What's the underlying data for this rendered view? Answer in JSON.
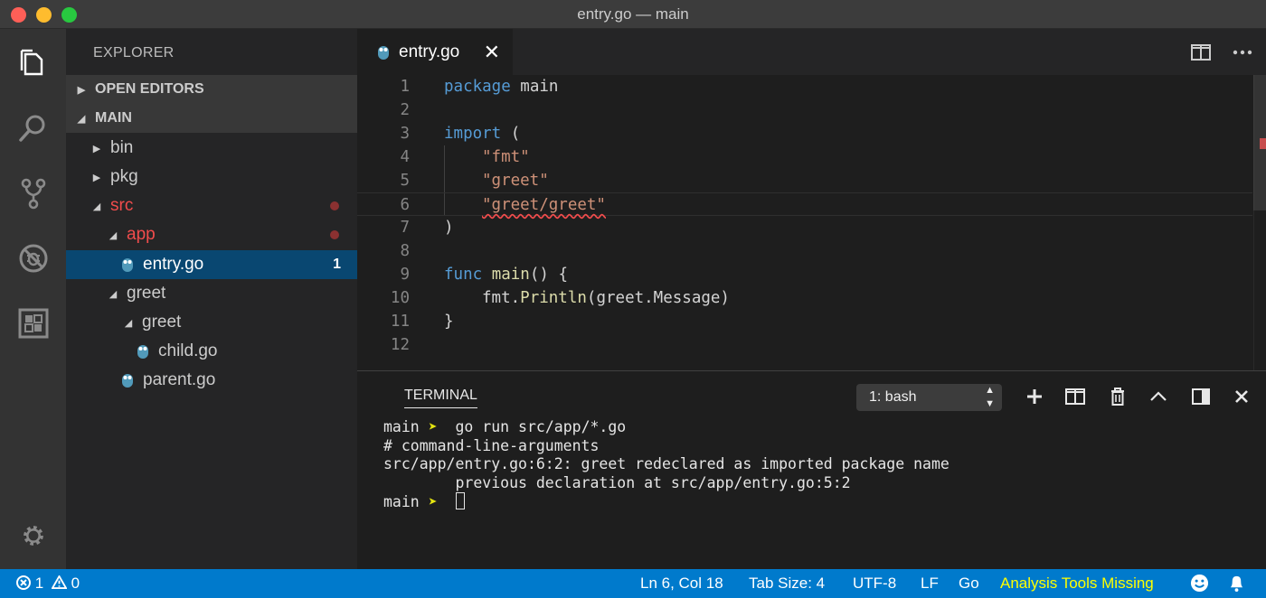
{
  "window": {
    "title": "entry.go — main"
  },
  "sidebar": {
    "title": "EXPLORER",
    "sections": {
      "open_editors": "OPEN EDITORS",
      "main": "MAIN"
    },
    "tree": [
      {
        "label": "bin"
      },
      {
        "label": "pkg"
      },
      {
        "label": "src"
      },
      {
        "label": "app"
      },
      {
        "label": "entry.go",
        "problems": "1"
      },
      {
        "label": "greet"
      },
      {
        "label": "greet"
      },
      {
        "label": "child.go"
      },
      {
        "label": "parent.go"
      }
    ]
  },
  "editor": {
    "tab_label": "entry.go",
    "tab_close": "✕",
    "lines": [
      {
        "num": "1"
      },
      {
        "num": "2"
      },
      {
        "num": "3"
      },
      {
        "num": "4"
      },
      {
        "num": "5"
      },
      {
        "num": "6"
      },
      {
        "num": "7"
      },
      {
        "num": "8"
      },
      {
        "num": "9"
      },
      {
        "num": "10"
      },
      {
        "num": "11"
      },
      {
        "num": "12"
      }
    ],
    "code": {
      "l1_kw": "package",
      "l1_rest": " main",
      "l3_kw": "import",
      "l3_rest": " (",
      "l4": "\"fmt\"",
      "l5": "\"greet\"",
      "l6": "\"greet/greet\"",
      "l7": ")",
      "l9_kw": "func",
      "l9_fn": "main",
      "l9_rest": "() {",
      "l10_a": "fmt.",
      "l10_fn": "Println",
      "l10_b": "(greet.Message)",
      "l11": "}"
    }
  },
  "panel": {
    "title": "TERMINAL",
    "terminal_select": "1: bash",
    "lines": [
      {
        "prompt": "main",
        "arrow": "➤",
        "cmd": "  go run src/app/*.go"
      },
      {
        "text": "# command-line-arguments"
      },
      {
        "text": "src/app/entry.go:6:2: greet redeclared as imported package name"
      },
      {
        "text": "        previous declaration at src/app/entry.go:5:2"
      },
      {
        "prompt": "main",
        "arrow": "➤"
      }
    ]
  },
  "statusbar": {
    "errors": "1",
    "warnings": "0",
    "position": "Ln 6, Col 18",
    "tab_size": "Tab Size: 4",
    "encoding": "UTF-8",
    "eol": "LF",
    "language": "Go",
    "tools_warning": "Analysis Tools Missing"
  },
  "colors": {
    "statusbar": "#007acc",
    "selection": "#094771",
    "error": "#f14c4c",
    "warning_text": "#ffff00"
  },
  "icons": [
    "files-icon",
    "search-icon",
    "source-control-icon",
    "debug-icon",
    "extensions-icon",
    "gear-icon",
    "gopher-file-icon",
    "split-editor-icon",
    "more-icon",
    "plus-icon",
    "trash-icon",
    "chevron-up-icon",
    "toggle-panel-icon",
    "close-icon",
    "smiley-icon",
    "bell-icon"
  ]
}
